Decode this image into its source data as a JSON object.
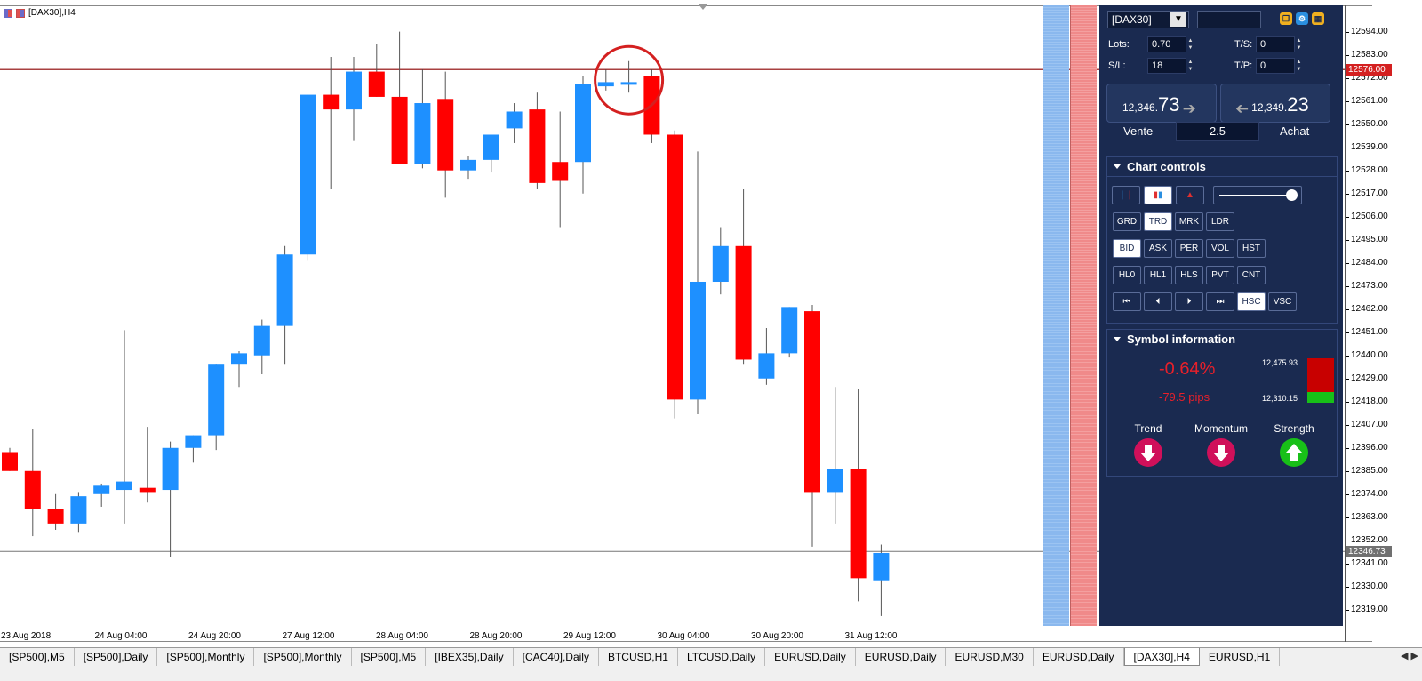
{
  "chart": {
    "title": "[DAX30],H4",
    "price_ticks": [
      "12594.00",
      "12583.00",
      "12572.00",
      "12561.00",
      "12550.00",
      "12539.00",
      "12528.00",
      "12517.00",
      "12506.00",
      "12495.00",
      "12484.00",
      "12473.00",
      "12462.00",
      "12451.00",
      "12440.00",
      "12429.00",
      "12418.00",
      "12407.00",
      "12396.00",
      "12385.00",
      "12374.00",
      "12363.00",
      "12352.00",
      "12341.00",
      "12330.00",
      "12319.00"
    ],
    "current_line_price": "12576.00",
    "bid_price_tag": "12346.73",
    "time_labels": [
      "23 Aug 2018",
      "24 Aug 04:00",
      "24 Aug 20:00",
      "27 Aug 12:00",
      "28 Aug 04:00",
      "28 Aug 20:00",
      "29 Aug 12:00",
      "30 Aug 04:00",
      "30 Aug 20:00",
      "31 Aug 12:00"
    ],
    "colors": {
      "bull": "#1e90ff",
      "bear": "#ff0000",
      "line": "#8b0000",
      "circle": "#d42020"
    }
  },
  "chart_data": {
    "type": "candlestick",
    "title": "[DAX30],H4",
    "y_range": [
      12313,
      12604
    ],
    "candles": [
      {
        "o": 12394,
        "h": 12396,
        "l": 12388,
        "c": 12385
      },
      {
        "o": 12385,
        "h": 12405,
        "l": 12354,
        "c": 12367
      },
      {
        "o": 12367,
        "h": 12374,
        "l": 12357,
        "c": 12360
      },
      {
        "o": 12360,
        "h": 12375,
        "l": 12356,
        "c": 12373
      },
      {
        "o": 12374,
        "h": 12379,
        "l": 12368,
        "c": 12378
      },
      {
        "o": 12376,
        "h": 12452,
        "l": 12360,
        "c": 12380
      },
      {
        "o": 12377,
        "h": 12406,
        "l": 12370,
        "c": 12375
      },
      {
        "o": 12376,
        "h": 12399,
        "l": 12344,
        "c": 12396
      },
      {
        "o": 12396,
        "h": 12400,
        "l": 12389,
        "c": 12402
      },
      {
        "o": 12402,
        "h": 12436,
        "l": 12395,
        "c": 12436
      },
      {
        "o": 12436,
        "h": 12442,
        "l": 12425,
        "c": 12441
      },
      {
        "o": 12440,
        "h": 12457,
        "l": 12431,
        "c": 12454
      },
      {
        "o": 12454,
        "h": 12492,
        "l": 12436,
        "c": 12488
      },
      {
        "o": 12488,
        "h": 12557,
        "l": 12485,
        "c": 12564
      },
      {
        "o": 12564,
        "h": 12582,
        "l": 12519,
        "c": 12557
      },
      {
        "o": 12557,
        "h": 12582,
        "l": 12542,
        "c": 12575
      },
      {
        "o": 12575,
        "h": 12588,
        "l": 12574,
        "c": 12563
      },
      {
        "o": 12563,
        "h": 12594,
        "l": 12536,
        "c": 12531
      },
      {
        "o": 12531,
        "h": 12576,
        "l": 12529,
        "c": 12560
      },
      {
        "o": 12562,
        "h": 12575,
        "l": 12515,
        "c": 12528
      },
      {
        "o": 12528,
        "h": 12535,
        "l": 12524,
        "c": 12533
      },
      {
        "o": 12533,
        "h": 12545,
        "l": 12527,
        "c": 12545
      },
      {
        "o": 12548,
        "h": 12560,
        "l": 12541,
        "c": 12556
      },
      {
        "o": 12557,
        "h": 12565,
        "l": 12519,
        "c": 12522
      },
      {
        "o": 12532,
        "h": 12556,
        "l": 12501,
        "c": 12523
      },
      {
        "o": 12532,
        "h": 12573,
        "l": 12517,
        "c": 12569
      },
      {
        "o": 12568,
        "h": 12576,
        "l": 12566,
        "c": 12570
      },
      {
        "o": 12570,
        "h": 12580,
        "l": 12565,
        "c": 12570
      },
      {
        "o": 12573,
        "h": 12576,
        "l": 12541,
        "c": 12545
      },
      {
        "o": 12545,
        "h": 12547,
        "l": 12410,
        "c": 12419
      },
      {
        "o": 12419,
        "h": 12537,
        "l": 12412,
        "c": 12475
      },
      {
        "o": 12475,
        "h": 12501,
        "l": 12469,
        "c": 12492
      },
      {
        "o": 12492,
        "h": 12519,
        "l": 12436,
        "c": 12438
      },
      {
        "o": 12429,
        "h": 12453,
        "l": 12426,
        "c": 12441
      },
      {
        "o": 12441,
        "h": 12463,
        "l": 12439,
        "c": 12463
      },
      {
        "o": 12461,
        "h": 12464,
        "l": 12349,
        "c": 12375
      },
      {
        "o": 12375,
        "h": 12425,
        "l": 12360,
        "c": 12386
      },
      {
        "o": 12386,
        "h": 12424,
        "l": 12323,
        "c": 12334
      },
      {
        "o": 12333,
        "h": 12350,
        "l": 12316,
        "c": 12346
      }
    ],
    "hlines": [
      12576.0,
      12346.73
    ]
  },
  "panel": {
    "symbol": "[DAX30]",
    "lots_label": "Lots:",
    "lots_value": "0.70",
    "ts_label": "T/S:",
    "ts_value": "0",
    "sl_label": "S/L:",
    "sl_value": "18",
    "tp_label": "T/P:",
    "tp_value": "0",
    "sell_small": "12,346.",
    "sell_big": "73",
    "buy_small": "12,349.",
    "buy_big": "23",
    "sell_label": "Vente",
    "buy_label": "Achat",
    "spread": "2.5",
    "chart_controls_title": "Chart controls",
    "buttons_row1": [
      "GRD",
      "TRD",
      "MRK",
      "LDR"
    ],
    "buttons_row2": [
      "BID",
      "ASK",
      "PER",
      "VOL",
      "HST"
    ],
    "buttons_row3": [
      "HL0",
      "HL1",
      "HLS",
      "PVT",
      "CNT"
    ],
    "buttons_row4": [
      "⏮",
      "⏴",
      "⏵",
      "⏭",
      "HSC",
      "VSC"
    ],
    "symbol_info_title": "Symbol information",
    "change_pct": "-0.64%",
    "change_pips": "-79.5 pips",
    "high_val": "12,475.93",
    "low_val": "12,310.15",
    "trend_label": "Trend",
    "momentum_label": "Momentum",
    "strength_label": "Strength"
  },
  "tabs": [
    "[SP500],M5",
    "[SP500],Daily",
    "[SP500],Monthly",
    "[SP500],Monthly",
    "[SP500],M5",
    "[IBEX35],Daily",
    "[CAC40],Daily",
    "BTCUSD,H1",
    "LTCUSD,Daily",
    "EURUSD,Daily",
    "EURUSD,Daily",
    "EURUSD,M30",
    "EURUSD,Daily",
    "[DAX30],H4",
    "EURUSD,H1"
  ],
  "active_tab_index": 13
}
